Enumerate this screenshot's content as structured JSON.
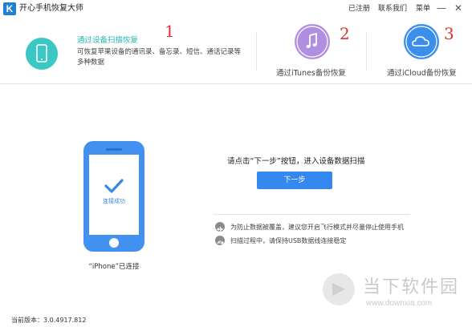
{
  "app": {
    "logo_letter": "K",
    "title": "开心手机恢复大师"
  },
  "menu": {
    "registered": "已注册",
    "contact": "联系我们",
    "menu": "菜单",
    "minimize": "—",
    "close": "✕"
  },
  "modes": {
    "device_scan": {
      "title": "通过设备扫描恢复",
      "desc": "可恢复苹果设备的通讯录、备忘录、短信、通话记录等多种数据",
      "annotation": "1"
    },
    "itunes": {
      "label": "通过iTunes备份恢复",
      "annotation": "2"
    },
    "icloud": {
      "label": "通过iCloud备份恢复",
      "annotation": "3"
    }
  },
  "phone": {
    "status": "连接成功",
    "caption": "“iPhone”已连接"
  },
  "main": {
    "prompt": "请点击“下一步”按钮，进入设备数据扫描",
    "next_button": "下一步",
    "tips": [
      "为防止数据被覆盖，建议您开启飞行模式并尽量停止使用手机",
      "扫描过程中，请保持USB数据线连接稳定"
    ]
  },
  "footer": {
    "version": "当前版本：3.0.4917.812"
  },
  "watermark": {
    "name": "当下软件园",
    "url": "www.downxia.com"
  },
  "colors": {
    "accent_teal": "#3bc8c4",
    "accent_purple": "#b08fe0",
    "accent_blue": "#4291f0",
    "annotation_red": "#e03030"
  },
  "icons": [
    "phone-icon",
    "music-note-icon",
    "cloud-icon",
    "check-icon",
    "airplane-icon",
    "usb-icon"
  ]
}
